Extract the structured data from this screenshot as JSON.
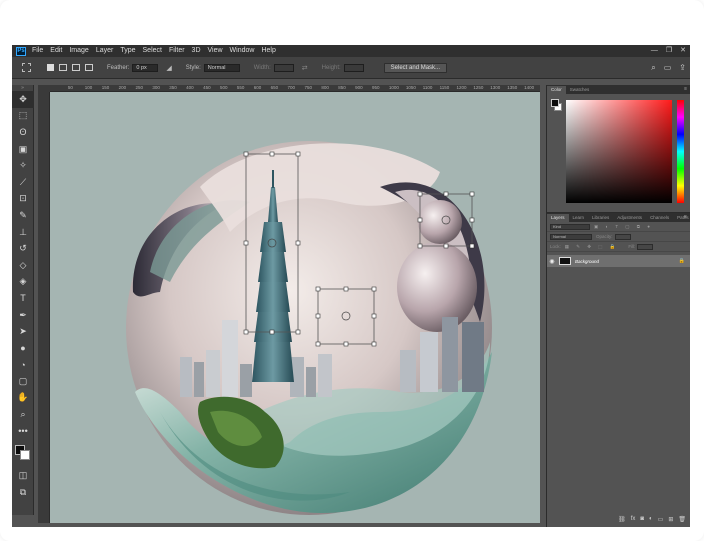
{
  "app": {
    "logo": "Ps",
    "menu": [
      "File",
      "Edit",
      "Image",
      "Layer",
      "Type",
      "Select",
      "Filter",
      "3D",
      "View",
      "Window",
      "Help"
    ],
    "window_controls": [
      "—",
      "❐",
      "✕"
    ]
  },
  "options": {
    "feather_label": "Feather:",
    "feather_value": "0 px",
    "style_label": "Style:",
    "style_value": "Normal",
    "width_label": "Width:",
    "height_label": "Height:",
    "select_mask": "Select and Mask..."
  },
  "rulers": {
    "ticks": [
      "50",
      "100",
      "150",
      "200",
      "250",
      "300",
      "350",
      "400",
      "450",
      "500",
      "550",
      "600",
      "650",
      "700",
      "750",
      "800",
      "850",
      "900",
      "950",
      "1000",
      "1050",
      "1100",
      "1150",
      "1200",
      "1250",
      "1300",
      "1350",
      "1400"
    ]
  },
  "color_panel": {
    "tabs": [
      "Color",
      "Swatches"
    ]
  },
  "layers_panel": {
    "tabs": [
      "Layers",
      "Learn",
      "Libraries",
      "Adjustments",
      "Channels",
      "Paths"
    ],
    "kind_label": "Kind",
    "blend_mode": "Normal",
    "opacity_label": "Opacity:",
    "lock_label": "Lock:",
    "fill_label": "Fill:",
    "layer_name": "Background"
  },
  "colors": {
    "canvas_bg": "#a5b5b2",
    "accent": "#31a8ff"
  }
}
